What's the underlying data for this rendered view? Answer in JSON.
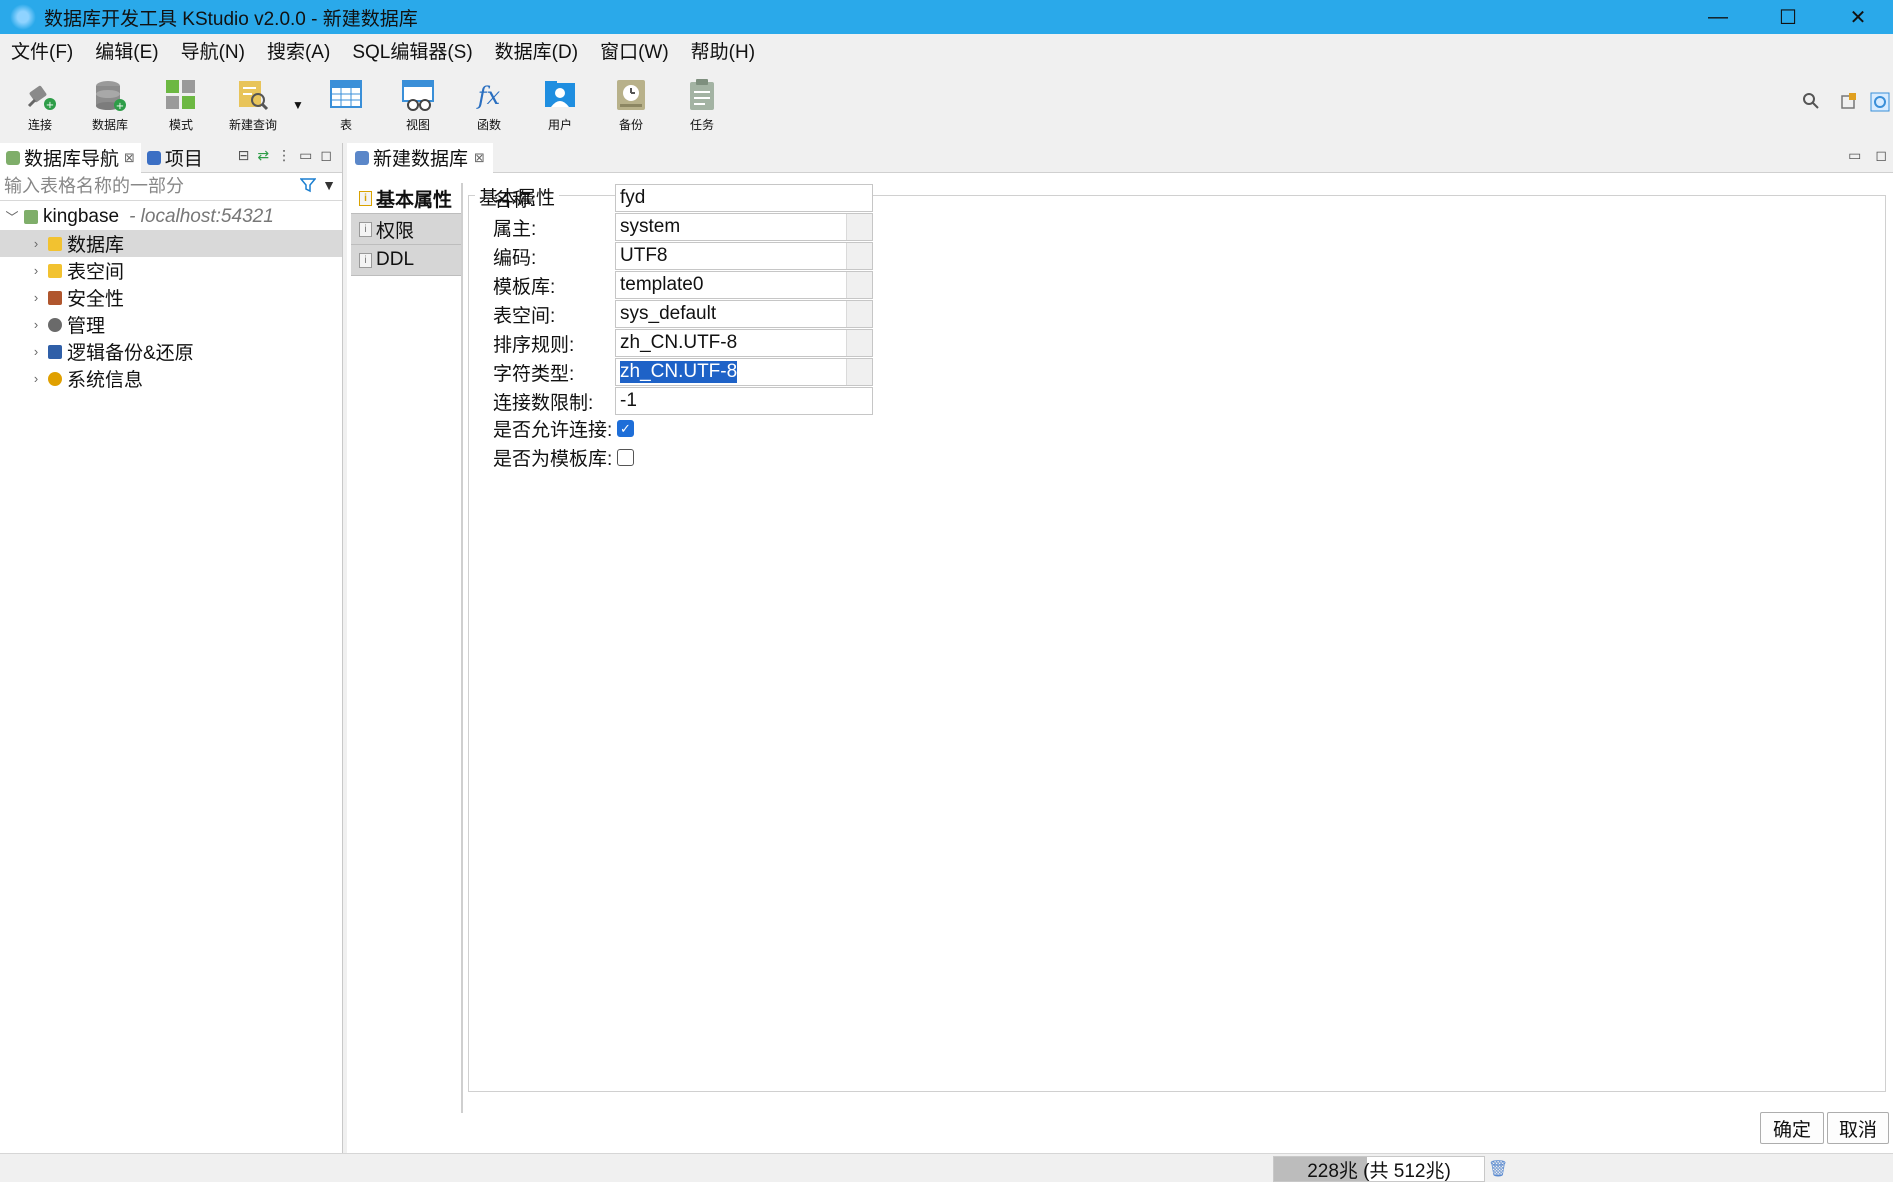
{
  "window": {
    "title": "数据库开发工具 KStudio v2.0.0 - 新建数据库",
    "controls": {
      "minimize": "—",
      "maximize": "☐",
      "close": "✕"
    }
  },
  "menu": [
    "文件(F)",
    "编辑(E)",
    "导航(N)",
    "搜索(A)",
    "SQL编辑器(S)",
    "数据库(D)",
    "窗口(W)",
    "帮助(H)"
  ],
  "toolbar": {
    "items": [
      {
        "label": "连接",
        "icon": "plug-icon"
      },
      {
        "label": "数据库",
        "icon": "database-icon"
      },
      {
        "label": "模式",
        "icon": "schema-icon"
      },
      {
        "label": "新建查询",
        "icon": "new-query-icon"
      },
      {
        "label": "表",
        "icon": "table-icon"
      },
      {
        "label": "视图",
        "icon": "view-icon"
      },
      {
        "label": "函数",
        "icon": "function-icon",
        "glyph": "fx"
      },
      {
        "label": "用户",
        "icon": "user-icon"
      },
      {
        "label": "备份",
        "icon": "backup-icon"
      },
      {
        "label": "任务",
        "icon": "task-icon"
      }
    ],
    "dropdown_glyph": "▼"
  },
  "left_panel": {
    "tabs": [
      {
        "label": "数据库导航",
        "close": "⊠"
      },
      {
        "label": "项目"
      }
    ],
    "filter_placeholder": "输入表格名称的一部分",
    "tree": {
      "root": {
        "name": "kingbase",
        "host": "- localhost:54321"
      },
      "children": [
        "数据库",
        "表空间",
        "安全性",
        "管理",
        "逻辑备份&还原",
        "系统信息"
      ]
    }
  },
  "editor": {
    "tab": {
      "label": "新建数据库",
      "close": "⊠"
    },
    "side_tabs": [
      "基本属性",
      "权限",
      "DDL"
    ],
    "group_title": "基本属性",
    "fields": [
      {
        "label": "名称:",
        "value": "fyd"
      },
      {
        "label": "属主:",
        "value": "system"
      },
      {
        "label": "编码:",
        "value": "UTF8"
      },
      {
        "label": "模板库:",
        "value": "template0"
      },
      {
        "label": "表空间:",
        "value": "sys_default"
      },
      {
        "label": "排序规则:",
        "value": "zh_CN.UTF-8"
      },
      {
        "label": "字符类型:",
        "value": "zh_CN.UTF-8"
      },
      {
        "label": "连接数限制:",
        "value": "-1"
      }
    ],
    "checkboxes": [
      {
        "label": "是否允许连接:",
        "checked": true
      },
      {
        "label": "是否为模板库:",
        "checked": false
      }
    ],
    "buttons": {
      "ok": "确定",
      "cancel": "取消"
    }
  },
  "status": {
    "memory": "228兆 (共 512兆)",
    "memory_used_fraction": 0.445
  },
  "colors": {
    "titlebar": "#2aa9ea",
    "selection": "#1e62c7",
    "checkbox": "#1e6ed8"
  }
}
